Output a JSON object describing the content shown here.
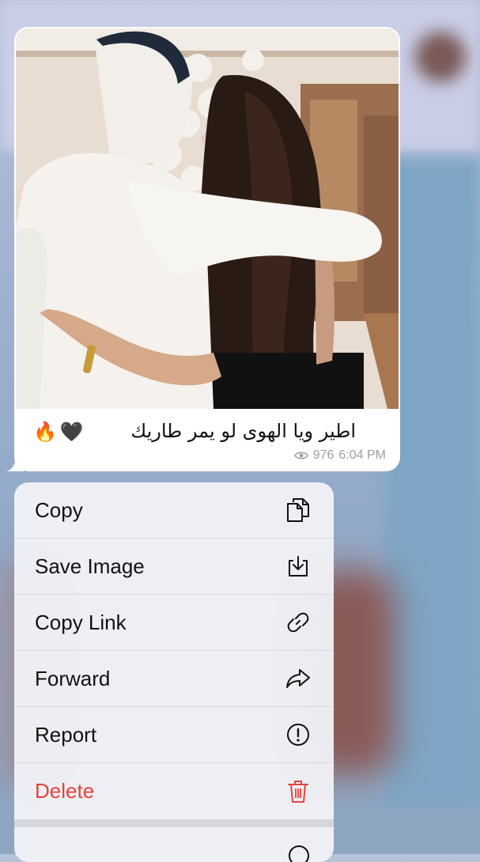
{
  "message": {
    "caption": "اطير ويا الهوى لو يمر طاريك",
    "caption_emoji": [
      "🔥",
      "🖤"
    ],
    "views": "976",
    "time": "6:04 PM"
  },
  "menu": {
    "items": [
      {
        "label": "Copy",
        "icon": "copy-icon"
      },
      {
        "label": "Save Image",
        "icon": "download-icon"
      },
      {
        "label": "Copy Link",
        "icon": "link-icon"
      },
      {
        "label": "Forward",
        "icon": "forward-icon"
      },
      {
        "label": "Report",
        "icon": "report-icon"
      },
      {
        "label": "Delete",
        "icon": "trash-icon",
        "color": "#e5443b"
      }
    ]
  }
}
